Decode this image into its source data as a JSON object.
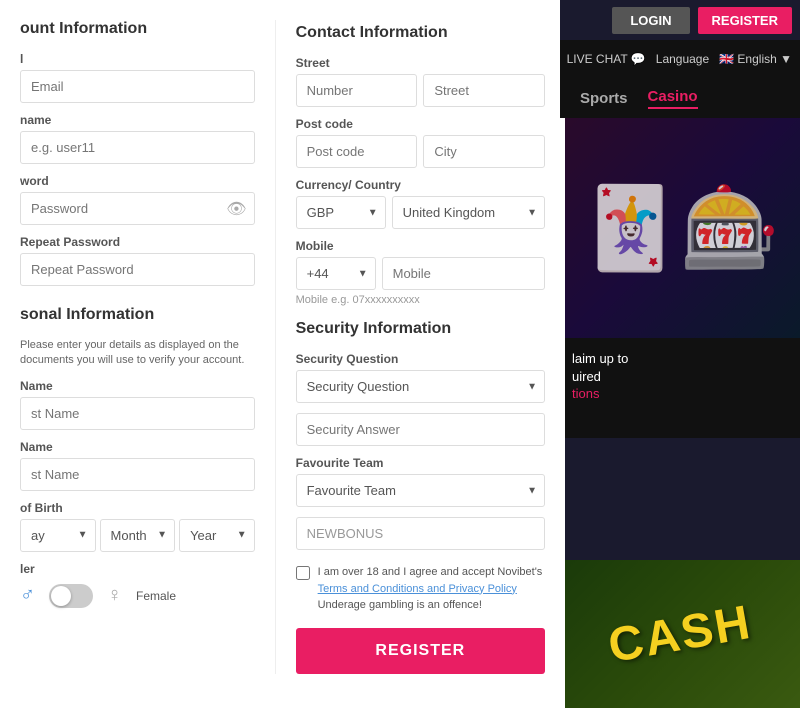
{
  "topNav": {
    "loginLabel": "LOGIN",
    "registerLabel": "REGISTER"
  },
  "secondNav": {
    "liveChatLabel": "LIVE CHAT 💬",
    "languageLabel": "Language",
    "englishLabel": "🇬🇧 English ▼"
  },
  "sportsTabs": {
    "sportsLabel": "Sports",
    "casinoLabel": "Casino"
  },
  "promo": {
    "text": "laim up to",
    "subtext": "uired",
    "link": "tions"
  },
  "leftCol": {
    "accountTitle": "ount Information",
    "emailLabel": "l",
    "emailPlaceholder": "Email",
    "usernameLabel": "name",
    "usernamePlaceholder": "e.g. user11",
    "passwordLabel": "word",
    "passwordPlaceholder": "Password",
    "repeatPasswordLabel": "Repeat Password",
    "repeatPasswordPlaceholder": "Repeat Password",
    "personalTitle": "sonal Information",
    "personalNote": "Please enter your details as displayed on the documents you will use to verify your account.",
    "firstNameLabel": "Name",
    "firstNamePlaceholder": "st Name",
    "lastNameLabel": "Name",
    "lastNamePlaceholder": "st Name",
    "dobLabel": "of Birth",
    "dayLabel": "ay",
    "monthLabel": "Month",
    "yearLabel": "Year",
    "genderLabel": "ler",
    "maleLabel": "ale",
    "femaleLabel": "Female"
  },
  "rightCol": {
    "contactTitle": "Contact Information",
    "streetLabel": "Street",
    "numberPlaceholder": "Number",
    "streetPlaceholder": "Street",
    "postCodeLabel": "Post code",
    "postCodePlaceholder": "Post code",
    "cityPlaceholder": "City",
    "currencyCountryLabel": "Currency/ Country",
    "currencyOptions": [
      "GBP"
    ],
    "countryOptions": [
      "United Kingdom"
    ],
    "mobileLabel": "Mobile",
    "mobileCodeOptions": [
      "+44"
    ],
    "mobilePlaceholder": "Mobile",
    "mobileHint": "Mobile e.g. 07xxxxxxxxxx",
    "securityTitle": "Security Information",
    "securityQuestionLabel": "Security Question",
    "securityQuestionPlaceholder": "Security Question",
    "securityAnswerPlaceholder": "Security Answer",
    "favouriteTeamLabel": "Favourite Team",
    "favouriteTeamPlaceholder": "Favourite Team",
    "bonusCode": "NEWBONUS",
    "checkboxText": "I am over 18 and I agree and accept Novibet's ",
    "termsLink": "Terms and Conditions  and Privacy Policy",
    "underageText": "Underage gambling is an offence!",
    "registerButtonLabel": "REGISTER"
  }
}
